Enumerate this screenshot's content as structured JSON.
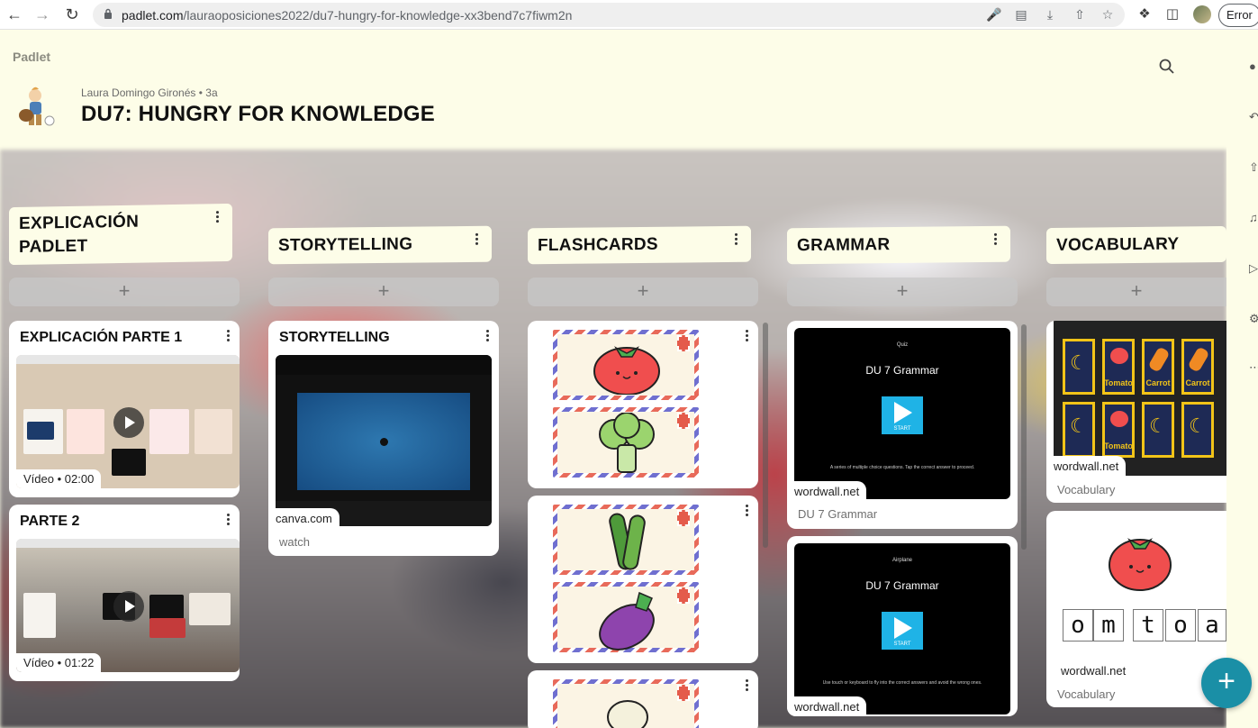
{
  "browser": {
    "url_host": "padlet.com",
    "url_path": "/lauraoposiciones2022/du7-hungry-for-knowledge-xx3bend7c7fiwm2n",
    "error_label": "Error"
  },
  "header": {
    "logo": "Padlet",
    "author": "Laura Domingo Gironés • 3a",
    "title": "DU7: HUNGRY FOR KNOWLEDGE"
  },
  "columns": [
    {
      "title_line1": "EXPLICACIÓN",
      "title_line2": "PADLET",
      "add": "+",
      "cards": [
        {
          "title": "EXPLICACIÓN PARTE 1",
          "badge_type": "Vídeo",
          "badge_time": "02:00"
        },
        {
          "title": "PARTE 2",
          "badge_type": "Vídeo",
          "badge_time": "01:22"
        }
      ]
    },
    {
      "title": "STORYTELLING",
      "add": "+",
      "cards": [
        {
          "title": "STORYTELLING",
          "source": "canva.com",
          "caption": "watch"
        }
      ]
    },
    {
      "title": "FLASHCARDS",
      "add": "+",
      "cards": [
        {
          "items": [
            "tomato",
            "broccoli"
          ]
        },
        {
          "items": [
            "zucchini",
            "eggplant"
          ]
        },
        {
          "items": [
            "garlic"
          ]
        }
      ]
    },
    {
      "title": "GRAMMAR",
      "add": "+",
      "cards": [
        {
          "game_small": "Quiz",
          "game_title": "DU 7 Grammar",
          "start": "START",
          "game_desc": "A series of multiple choice questions. Tap the correct answer to proceed.",
          "source": "wordwall.net",
          "caption": "DU 7 Grammar"
        },
        {
          "game_small": "Airplane",
          "game_title": "DU 7 Grammar",
          "start": "START",
          "game_desc": "Use touch or keyboard to fly into the correct answers and avoid the wrong ones.",
          "source": "wordwall.net"
        }
      ]
    },
    {
      "title": "VOCABULARY",
      "add": "+",
      "cards": [
        {
          "tiles": [
            "Tomato",
            "Carrot",
            "Carrot",
            "Tomato"
          ],
          "source": "wordwall.net",
          "caption": "Vocabulary"
        },
        {
          "letters": [
            "o",
            "m",
            "t",
            "o",
            "a"
          ],
          "source": "wordwall.net",
          "caption": "Vocabulary"
        }
      ]
    }
  ],
  "icons": {
    "back": "arrow-left-icon",
    "forward": "arrow-right-icon",
    "reload": "reload-icon",
    "search": "search-icon",
    "add_post": "plus-icon"
  },
  "colors": {
    "header_bg": "#fdfde8",
    "fab": "#1a8fa6",
    "start_button": "#1fb3e6"
  }
}
